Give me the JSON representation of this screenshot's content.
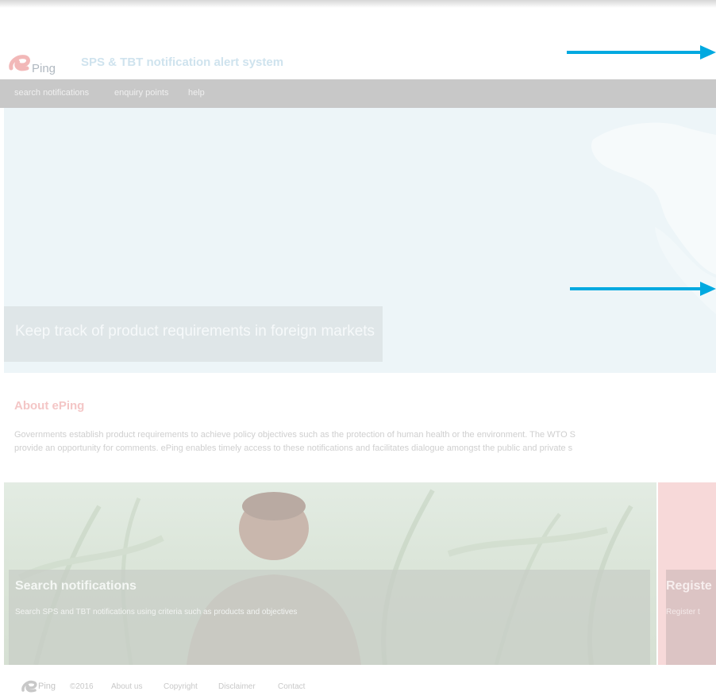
{
  "header": {
    "logo_text": "Ping",
    "tagline": "SPS & TBT notification alert system"
  },
  "nav": {
    "items": [
      {
        "label": "search notifications"
      },
      {
        "label": "enquiry points"
      },
      {
        "label": "help"
      }
    ]
  },
  "hero": {
    "caption": "Keep track of product requirements in foreign markets"
  },
  "about": {
    "title": "About ePing",
    "line1": "Governments establish product requirements to achieve policy objectives such as the protection of human health or the environment. The WTO S",
    "line2": "provide an opportunity for comments. ePing enables timely access to these notifications and facilitates dialogue amongst the public and private s"
  },
  "features": {
    "search": {
      "title": "Search notifications",
      "description": "Search SPS and TBT notifications using criteria such as products and objectives"
    },
    "register": {
      "title": "Registe",
      "description": "Register t"
    }
  },
  "footer": {
    "logo_text": "Ping",
    "copyright": "©2016",
    "links": [
      {
        "label": "About us"
      },
      {
        "label": "Copyright"
      },
      {
        "label": "Disclaimer"
      },
      {
        "label": "Contact"
      }
    ]
  },
  "colors": {
    "brand_red": "#f4c6c6",
    "accent_blue": "#00a9e0",
    "nav_bar": "#c8c8c8"
  }
}
